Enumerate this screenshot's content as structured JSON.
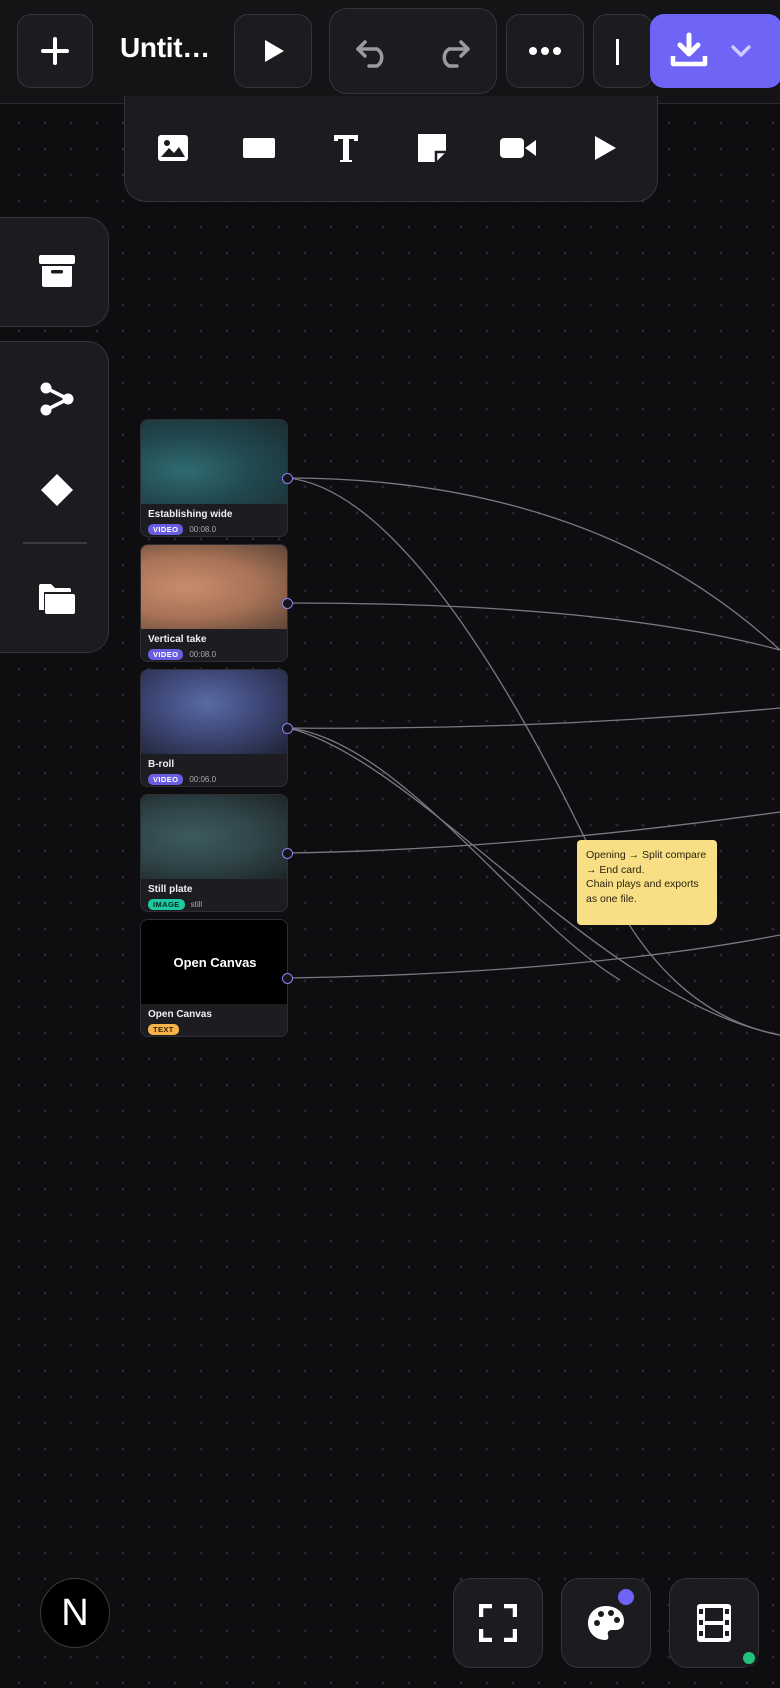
{
  "project": {
    "title": "Untit…"
  },
  "toolbar": {
    "add": "add-icon",
    "play": "play-icon",
    "undo": "undo-icon",
    "redo": "redo-icon",
    "more": "more-icon",
    "export": "download-icon",
    "export_menu": "chevron-down-icon"
  },
  "insert_tools": [
    "image-icon",
    "rectangle-icon",
    "text-icon",
    "sticky-note-icon",
    "video-icon",
    "play-icon"
  ],
  "rail_tools": [
    "archive-icon",
    "share-nodes-icon",
    "diamond-icon",
    "folder-icon"
  ],
  "nodes": [
    {
      "name": "Establishing wide",
      "kind": "VIDEO",
      "duration": "00:08.0"
    },
    {
      "name": "Vertical take",
      "kind": "VIDEO",
      "duration": "00:08.0"
    },
    {
      "name": "B-roll",
      "kind": "VIDEO",
      "duration": "00:06.0"
    },
    {
      "name": "Still plate",
      "kind": "IMAGE",
      "duration": "still"
    },
    {
      "name": "Open Canvas",
      "kind": "TEXT",
      "preview": "Open Canvas"
    }
  ],
  "sticky_note": {
    "line1": "Opening → Split compare",
    "line2": "→ End card.",
    "line3": "Chain plays and exports",
    "line4": "as one file."
  },
  "bottom": {
    "logo": "N",
    "fullscreen": "fullscreen-icon",
    "theme": "palette-icon",
    "timeline": "film-icon"
  },
  "colors": {
    "accent": "#6e64f5",
    "canvas": "#0e0e11",
    "panel": "#1c1c20",
    "sticky": "#f8df85",
    "status_online": "#22c27a"
  }
}
